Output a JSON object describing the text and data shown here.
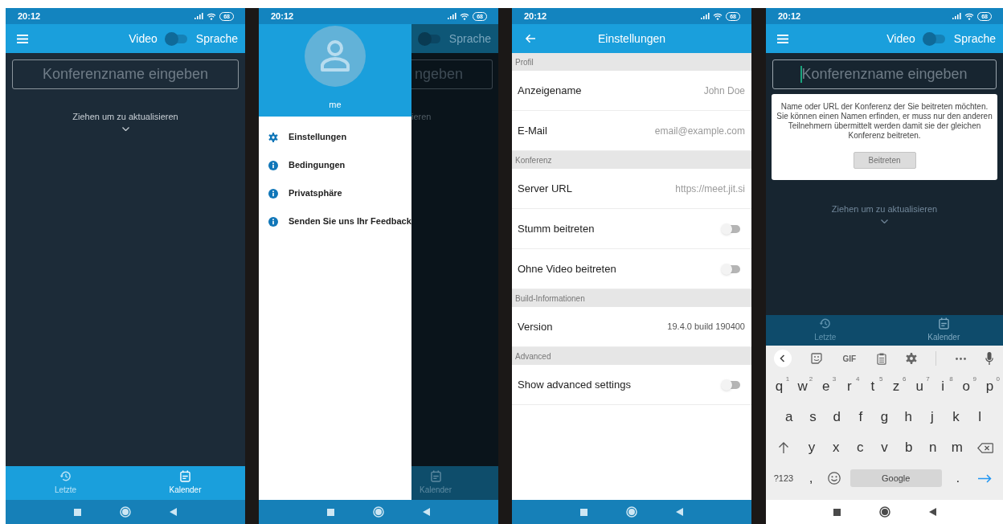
{
  "screens": [
    {
      "kind": "home",
      "status_bar": {
        "time": "20:12",
        "battery": "68"
      },
      "app_bar": {
        "video_label": "Video",
        "voice_label": "Sprache",
        "on": false
      },
      "room_field": {
        "placeholder": "Konferenzname eingeben",
        "focused": false
      },
      "pull_hint": "Ziehen um zu aktualisieren",
      "tabs": [
        {
          "label": "Letzte",
          "selected": false
        },
        {
          "label": "Kalender",
          "selected": true
        }
      ]
    },
    {
      "kind": "drawer",
      "status_bar": {
        "time": "20:12",
        "battery": "68"
      },
      "drawer": {
        "user_name": "me",
        "items": [
          {
            "label": "Einstellungen"
          },
          {
            "label": "Bedingungen"
          },
          {
            "label": "Privatsphäre"
          },
          {
            "label": "Senden Sie uns Ihr Feedback"
          }
        ]
      },
      "behind": {
        "voice_label": "Sprache",
        "field_text": "ngeben",
        "hint_text": "ieren",
        "tab_label": "Kalender"
      }
    },
    {
      "kind": "settings",
      "status_bar": {
        "time": "20:12",
        "battery": "68"
      },
      "title": "Einstellungen",
      "sections": [
        {
          "title": "Profil",
          "rows": [
            {
              "kind": "value",
              "label": "Anzeigename",
              "value": "John Doe"
            },
            {
              "kind": "value",
              "label": "E-Mail",
              "value": "email@example.com"
            }
          ]
        },
        {
          "title": "Konferenz",
          "rows": [
            {
              "kind": "value",
              "label": "Server URL",
              "value": "https://meet.jit.si"
            },
            {
              "kind": "toggle",
              "label": "Stumm beitreten",
              "on": false
            },
            {
              "kind": "toggle",
              "label": "Ohne Video beitreten",
              "on": false
            }
          ]
        },
        {
          "title": "Build-Informationen",
          "rows": [
            {
              "kind": "info",
              "label": "Version",
              "value": "19.4.0 build 190400"
            }
          ]
        },
        {
          "title": "Advanced",
          "rows": [
            {
              "kind": "toggle",
              "label": "Show advanced settings",
              "on": false
            }
          ]
        }
      ]
    },
    {
      "kind": "join",
      "status_bar": {
        "time": "20:12",
        "battery": "68"
      },
      "app_bar": {
        "video_label": "Video",
        "voice_label": "Sprache",
        "on": false
      },
      "room_field": {
        "placeholder": "Konferenzname eingeben",
        "focused": true
      },
      "tooltip": {
        "text": "Name oder URL der Konferenz der Sie beitreten möchten. Sie können einen Namen erfinden, er muss nur den anderen Teilnehmern übermittelt werden damit sie der gleichen Konferenz beitreten.",
        "button": {
          "label": "Beitreten",
          "disabled": true
        }
      },
      "pull_hint": "Ziehen um zu aktualisieren",
      "dimmed": true,
      "tabs": [
        {
          "label": "Letzte",
          "selected": false
        },
        {
          "label": "Kalender",
          "selected": true
        }
      ],
      "keyboard": {
        "toolbar": [
          {
            "kind": "back"
          },
          {
            "kind": "sticker"
          },
          {
            "kind": "gif",
            "label": "GIF"
          },
          {
            "kind": "clipboard"
          },
          {
            "kind": "settings"
          },
          {
            "kind": "more"
          },
          {
            "kind": "mic"
          }
        ],
        "key_rows": [
          {
            "keys": [
              {
                "kind": "char",
                "label": "q",
                "hint": "1"
              },
              {
                "kind": "char",
                "label": "w",
                "hint": "2"
              },
              {
                "kind": "char",
                "label": "e",
                "hint": "3"
              },
              {
                "kind": "char",
                "label": "r",
                "hint": "4"
              },
              {
                "kind": "char",
                "label": "t",
                "hint": "5"
              },
              {
                "kind": "char",
                "label": "z",
                "hint": "6"
              },
              {
                "kind": "char",
                "label": "u",
                "hint": "7"
              },
              {
                "kind": "char",
                "label": "i",
                "hint": "8"
              },
              {
                "kind": "char",
                "label": "o",
                "hint": "9"
              },
              {
                "kind": "char",
                "label": "p",
                "hint": "0"
              }
            ]
          },
          {
            "keys": [
              {
                "kind": "char",
                "label": "a"
              },
              {
                "kind": "char",
                "label": "s"
              },
              {
                "kind": "char",
                "label": "d"
              },
              {
                "kind": "char",
                "label": "f"
              },
              {
                "kind": "char",
                "label": "g"
              },
              {
                "kind": "char",
                "label": "h"
              },
              {
                "kind": "char",
                "label": "j"
              },
              {
                "kind": "char",
                "label": "k"
              },
              {
                "kind": "char",
                "label": "l"
              }
            ]
          },
          {
            "keys": [
              {
                "kind": "shift"
              },
              {
                "kind": "char",
                "label": "y"
              },
              {
                "kind": "char",
                "label": "x"
              },
              {
                "kind": "char",
                "label": "c"
              },
              {
                "kind": "char",
                "label": "v"
              },
              {
                "kind": "char",
                "label": "b"
              },
              {
                "kind": "char",
                "label": "n"
              },
              {
                "kind": "char",
                "label": "m"
              },
              {
                "kind": "backspace"
              }
            ]
          },
          {
            "keys": [
              {
                "kind": "mode",
                "label": "?123"
              },
              {
                "kind": "char",
                "label": ","
              },
              {
                "kind": "emoji"
              },
              {
                "kind": "space",
                "label": "Google"
              },
              {
                "kind": "char",
                "label": "."
              },
              {
                "kind": "enter"
              }
            ]
          }
        ]
      }
    }
  ]
}
